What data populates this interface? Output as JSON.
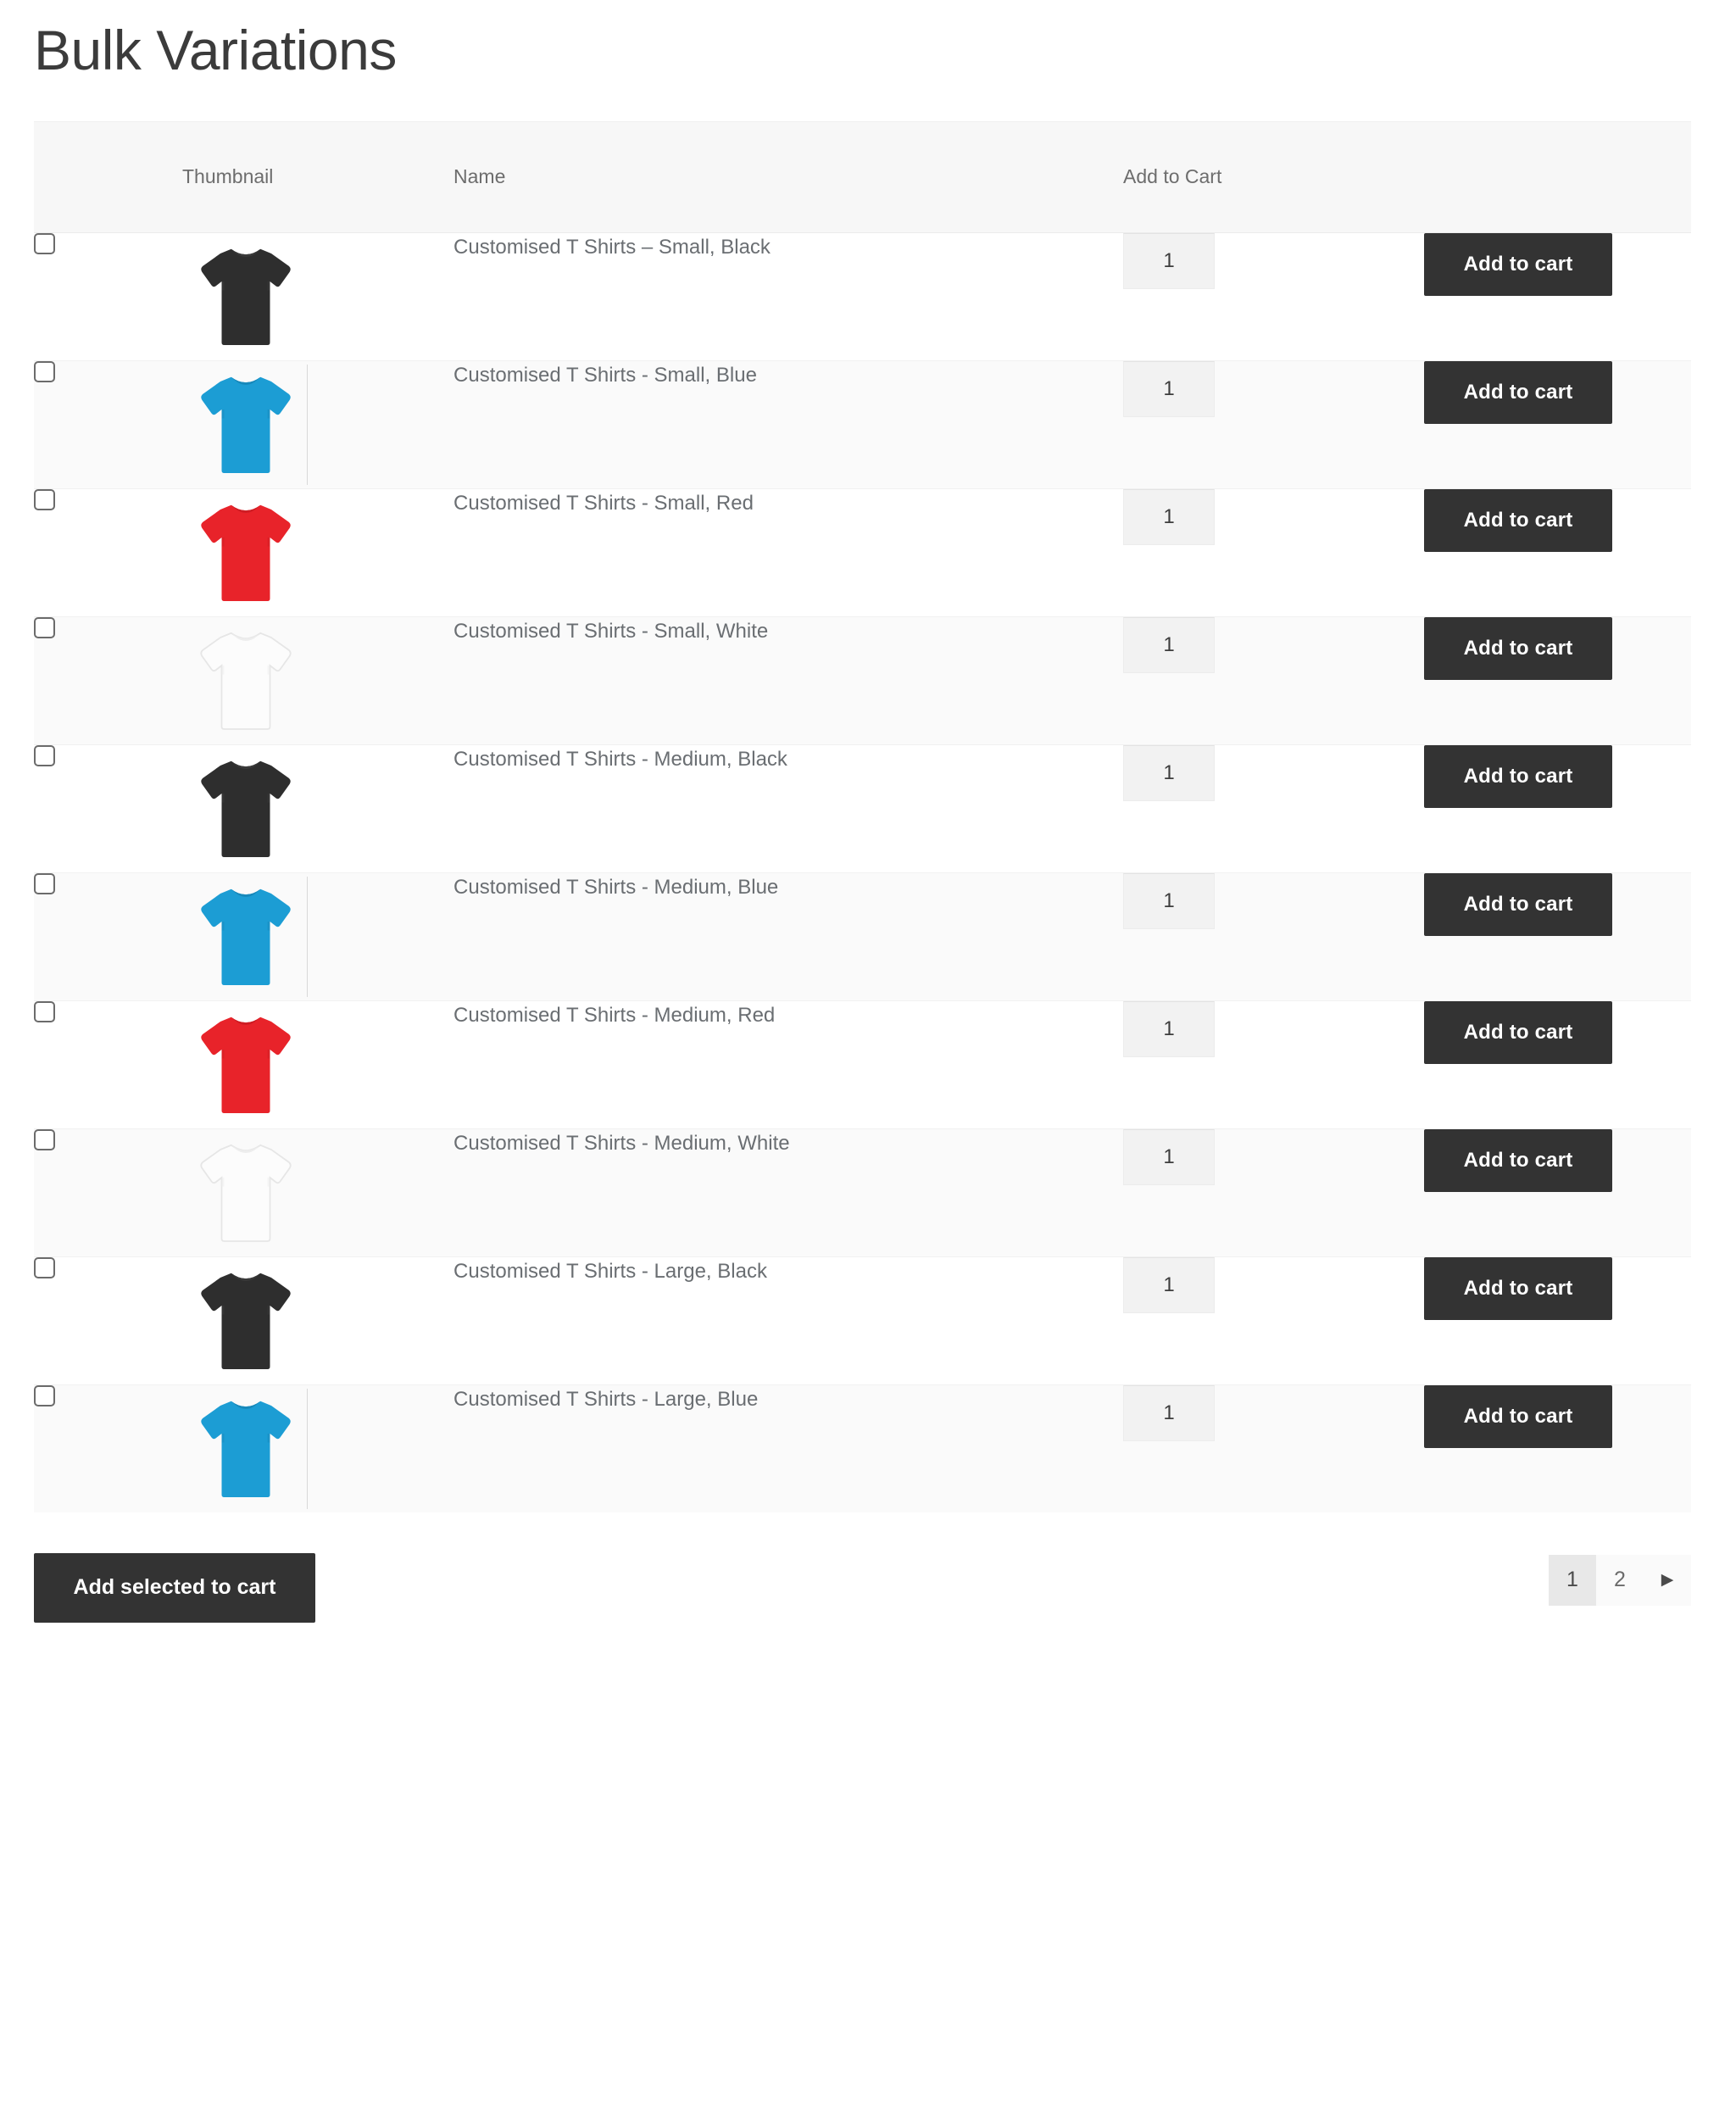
{
  "page": {
    "title": "Bulk Variations"
  },
  "table": {
    "headers": {
      "checkbox": "",
      "thumbnail": "Thumbnail",
      "name": "Name",
      "add_to_cart": "Add to Cart"
    },
    "add_to_cart_label": "Add to cart",
    "rows": [
      {
        "name": "Customised T Shirts – Small, Black",
        "quantity": "1",
        "thumbnail": "tshirt-black-icon",
        "color": "#2e2e2e",
        "shade": "#3a3a3a",
        "edge_line": false
      },
      {
        "name": "Customised T Shirts - Small, Blue",
        "quantity": "1",
        "thumbnail": "tshirt-blue-icon",
        "color": "#1c9dd4",
        "shade": "#1789bb",
        "edge_line": true
      },
      {
        "name": "Customised T Shirts - Small, Red",
        "quantity": "1",
        "thumbnail": "tshirt-red-icon",
        "color": "#e8232a",
        "shade": "#cf1d24",
        "edge_line": false
      },
      {
        "name": "Customised T Shirts - Small, White",
        "quantity": "1",
        "thumbnail": "tshirt-white-icon",
        "color": "#fcfcfc",
        "shade": "#ededed",
        "edge_line": false
      },
      {
        "name": "Customised T Shirts - Medium, Black",
        "quantity": "1",
        "thumbnail": "tshirt-black-icon",
        "color": "#2e2e2e",
        "shade": "#3a3a3a",
        "edge_line": false
      },
      {
        "name": "Customised T Shirts - Medium, Blue",
        "quantity": "1",
        "thumbnail": "tshirt-blue-icon",
        "color": "#1c9dd4",
        "shade": "#1789bb",
        "edge_line": true
      },
      {
        "name": "Customised T Shirts - Medium, Red",
        "quantity": "1",
        "thumbnail": "tshirt-red-icon",
        "color": "#e8232a",
        "shade": "#cf1d24",
        "edge_line": false
      },
      {
        "name": "Customised T Shirts - Medium, White",
        "quantity": "1",
        "thumbnail": "tshirt-white-icon",
        "color": "#fcfcfc",
        "shade": "#ededed",
        "edge_line": false
      },
      {
        "name": "Customised T Shirts - Large, Black",
        "quantity": "1",
        "thumbnail": "tshirt-black-icon",
        "color": "#2e2e2e",
        "shade": "#3a3a3a",
        "edge_line": false
      },
      {
        "name": "Customised T Shirts - Large, Blue",
        "quantity": "1",
        "thumbnail": "tshirt-blue-icon",
        "color": "#1c9dd4",
        "shade": "#1789bb",
        "edge_line": true
      }
    ]
  },
  "footer": {
    "add_selected_label": "Add selected to cart",
    "pagination": {
      "pages": [
        "1",
        "2"
      ],
      "active": "1",
      "next_icon": "chevron-right-icon",
      "next_glyph": "▶"
    }
  },
  "colors": {
    "button_dark": "#333333",
    "header_bg": "#f7f7f7",
    "row_alt_bg": "#fafafa",
    "text": "#6a6e72",
    "title": "#3b3b3b"
  }
}
